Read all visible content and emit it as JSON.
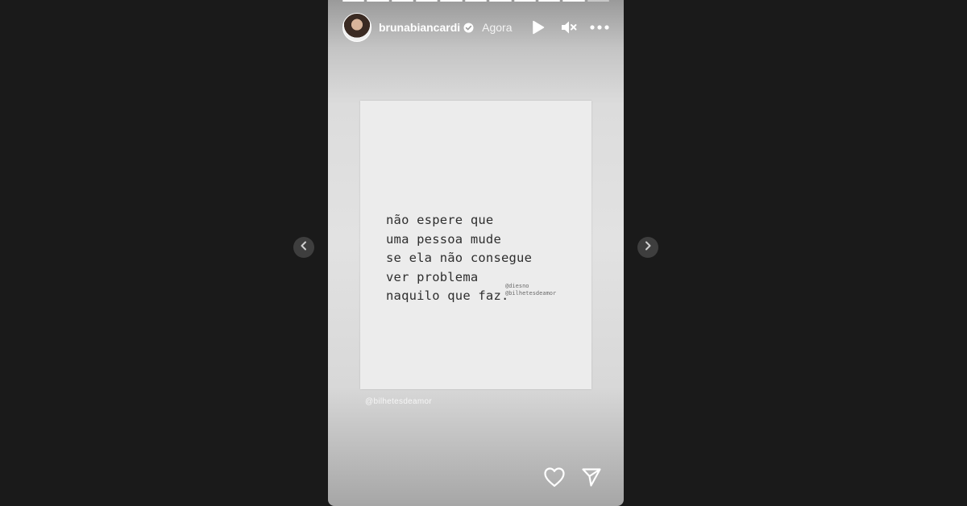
{
  "story": {
    "progress_total": 11,
    "progress_done": 10,
    "username": "brunabiancardi",
    "time": "Agora",
    "quote_lines": [
      "não espere que",
      "uma pessoa mude",
      "se ela não consegue",
      "ver problema",
      "naquilo que faz."
    ],
    "credits": [
      "@diesno",
      "@bilhetesdeamor"
    ],
    "sticker": "@bilhetesdeamor"
  },
  "icons": {
    "verified": "verified-badge-icon",
    "play": "play-icon",
    "mute": "mute-icon",
    "more": "more-icon",
    "like": "heart-icon",
    "share": "send-icon",
    "prev": "chevron-left-icon",
    "next": "chevron-right-icon"
  }
}
